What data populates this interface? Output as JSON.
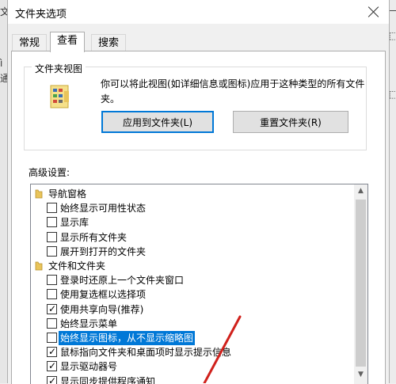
{
  "background": {
    "left_chars": [
      "文",
      "ì",
      "通"
    ],
    "right_chars": [
      "—",
      "⬚",
      "⬚"
    ]
  },
  "dialog": {
    "title": "文件夹选项",
    "tabs": [
      {
        "label": "常规",
        "active": false
      },
      {
        "label": "查看",
        "active": true
      },
      {
        "label": "搜索",
        "active": false
      }
    ],
    "folder_view": {
      "group_title": "文件夹视图",
      "description": "你可以将此视图(如详细信息或图标)应用于这种类型的所有文件夹。",
      "apply_button": "应用到文件夹(L)",
      "reset_button": "重置文件夹(R)"
    },
    "advanced": {
      "label": "高级设置:",
      "items": [
        {
          "kind": "category",
          "label": "导航窗格"
        },
        {
          "kind": "checkbox",
          "label": "始终显示可用性状态",
          "checked": false
        },
        {
          "kind": "checkbox",
          "label": "显示库",
          "checked": false
        },
        {
          "kind": "checkbox",
          "label": "显示所有文件夹",
          "checked": false
        },
        {
          "kind": "checkbox",
          "label": "展开到打开的文件夹",
          "checked": false
        },
        {
          "kind": "category",
          "label": "文件和文件夹"
        },
        {
          "kind": "checkbox",
          "label": "登录时还原上一个文件夹窗口",
          "checked": false
        },
        {
          "kind": "checkbox",
          "label": "使用复选框以选择项",
          "checked": false
        },
        {
          "kind": "checkbox",
          "label": "使用共享向导(推荐)",
          "checked": true
        },
        {
          "kind": "checkbox",
          "label": "始终显示菜单",
          "checked": false
        },
        {
          "kind": "checkbox",
          "label": "始终显示图标，从不显示缩略图",
          "checked": false,
          "selected": true
        },
        {
          "kind": "checkbox",
          "label": "鼠标指向文件夹和桌面项时显示提示信息",
          "checked": true
        },
        {
          "kind": "checkbox",
          "label": "显示驱动器号",
          "checked": true
        },
        {
          "kind": "checkbox",
          "label": "显示同步提供程序通知",
          "checked": true
        }
      ]
    }
  },
  "colors": {
    "selection": "#0078d7",
    "annotation_arrow": "#d0211c"
  }
}
